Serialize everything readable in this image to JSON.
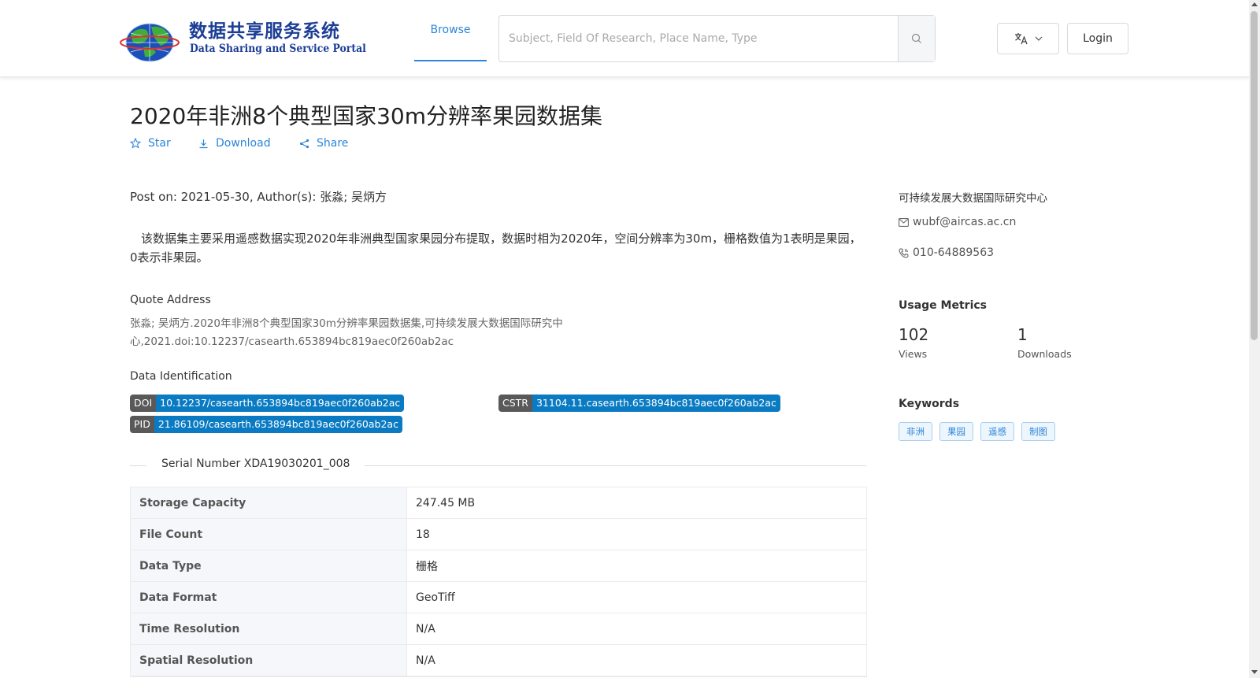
{
  "header": {
    "logo_cn": "数据共享服务系统",
    "logo_en": "Data Sharing and Service Portal",
    "nav_browse": "Browse",
    "search_placeholder": "Subject, Field Of Research, Place Name, Type",
    "login_label": "Login"
  },
  "dataset": {
    "title": "2020年非洲8个典型国家30m分辨率果园数据集",
    "actions": {
      "star": "Star",
      "download": "Download",
      "share": "Share"
    },
    "post_info": "Post on: 2021-05-30, Author(s): 张淼; 吴炳方",
    "description": "该数据集主要采用遥感数据实现2020年非洲典型国家果园分布提取，数据时相为2020年，空间分辨率为30m，栅格数值为1表明是果园，0表示非果园。",
    "quote_label": "Quote Address",
    "quote_text": "张淼; 吴炳方.2020年非洲8个典型国家30m分辨率果园数据集,可持续发展大数据国际研究中心,2021.doi:10.12237/casearth.653894bc819aec0f260ab2ac",
    "ident_label": "Data Identification",
    "identifiers": {
      "doi_key": "DOI",
      "doi_value": "10.12237/casearth.653894bc819aec0f260ab2ac",
      "cstr_key": "CSTR",
      "cstr_value": "31104.11.casearth.653894bc819aec0f260ab2ac",
      "pid_key": "PID",
      "pid_value": "21.86109/casearth.653894bc819aec0f260ab2ac"
    },
    "serial_number": "Serial Number XDA19030201_008",
    "table": [
      {
        "key": "Storage Capacity",
        "value": "247.45 MB"
      },
      {
        "key": "File Count",
        "value": "18"
      },
      {
        "key": "Data Type",
        "value": "栅格"
      },
      {
        "key": "Data Format",
        "value": "GeoTiff"
      },
      {
        "key": "Time Resolution",
        "value": "N/A"
      },
      {
        "key": "Spatial Resolution",
        "value": "N/A"
      }
    ]
  },
  "sidebar": {
    "organization": "可持续发展大数据国际研究中心",
    "email": "wubf@aircas.ac.cn",
    "phone": "010-64889563",
    "metrics_title": "Usage Metrics",
    "views_value": "102",
    "views_label": "Views",
    "downloads_value": "1",
    "downloads_label": "Downloads",
    "keywords_title": "Keywords",
    "keywords": [
      "非洲",
      "果园",
      "遥感",
      "制图"
    ]
  },
  "icons": {
    "search": "search-icon",
    "translate": "translate-icon",
    "chevron": "chevron-down-icon",
    "star": "star-icon",
    "download": "download-icon",
    "share": "share-icon",
    "mail": "mail-icon",
    "phone": "phone-icon"
  },
  "colors": {
    "accent": "#2b86d9",
    "id_value_bg": "#0a7bc2",
    "id_key_bg": "#595959",
    "logo_blue": "#1c3e95"
  }
}
